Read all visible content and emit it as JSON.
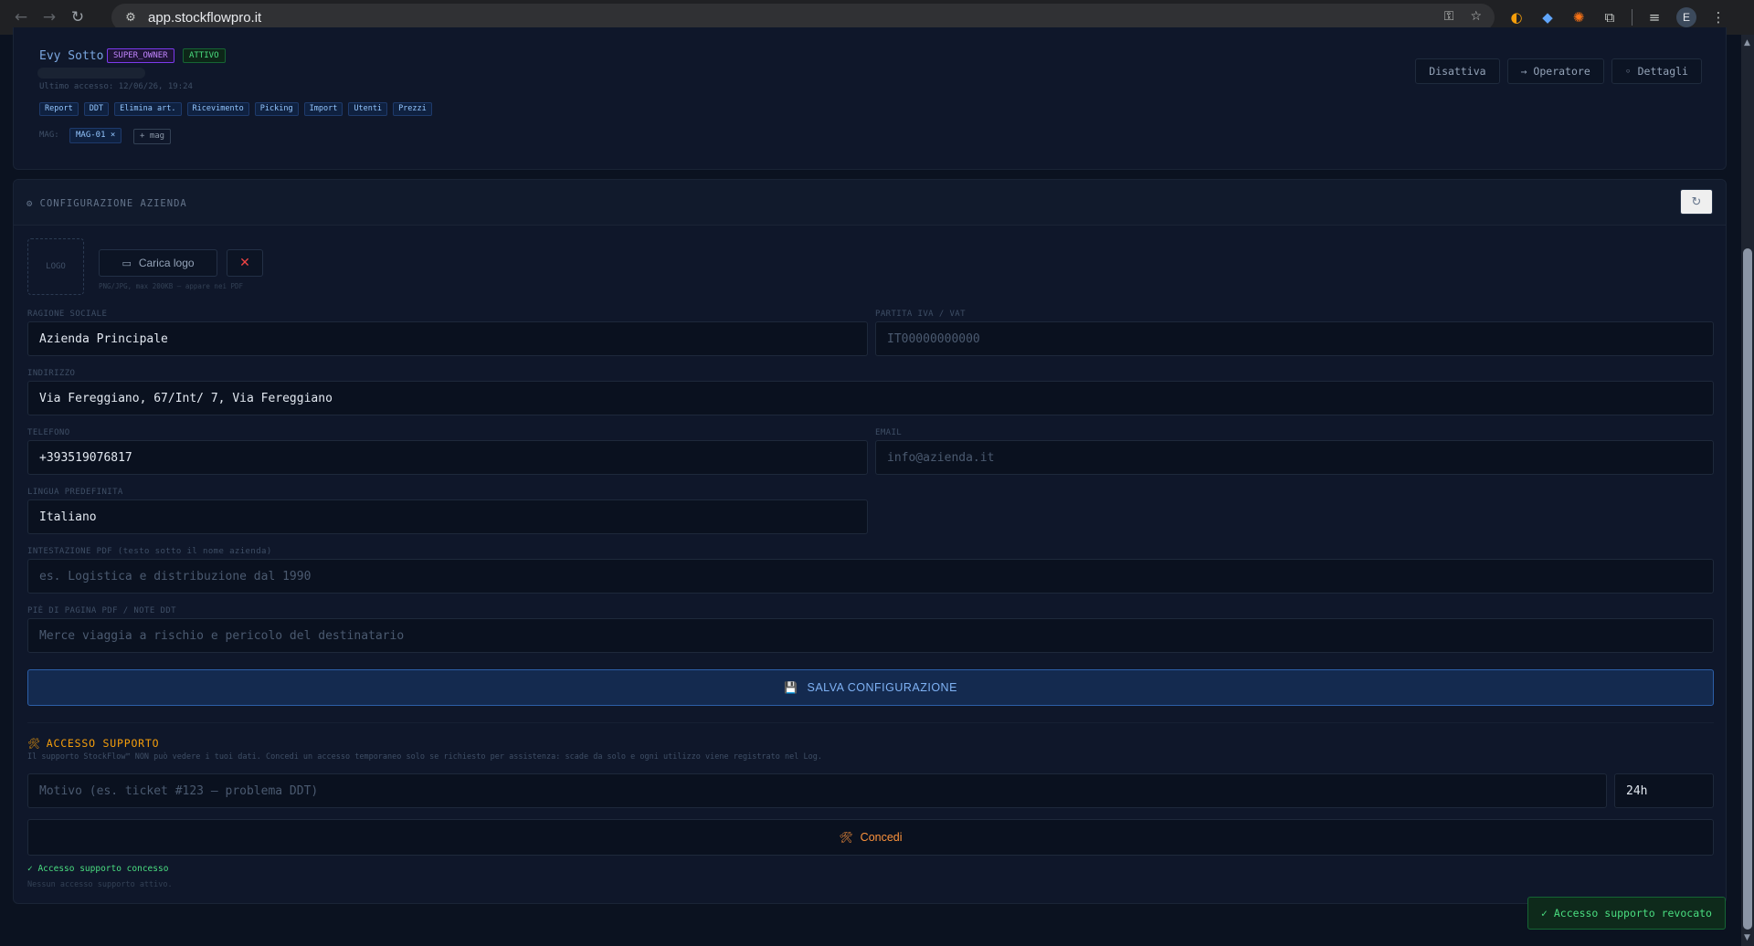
{
  "browser": {
    "url": "app.stockflowpro.it",
    "nav": {
      "back": "←",
      "forward": "→",
      "reload": "↻"
    },
    "omni_icons": [
      "key-icon",
      "star-icon"
    ],
    "extension_icons": [
      "extension-1-icon",
      "extension-2-icon",
      "extension-3-icon",
      "puzzle-icon",
      "media-icon"
    ],
    "profile_initial": "E",
    "menu": "⋮"
  },
  "user_card": {
    "name": "Evy Sotto",
    "role_badge": "SUPER_OWNER",
    "status_badge": "ATTIVO",
    "last_access": "Ultimo accesso: 12/06/26, 19:24",
    "permissions": [
      "Report",
      "DDT",
      "Elimina art.",
      "Ricevimento",
      "Picking",
      "Import",
      "Utenti",
      "Prezzi"
    ],
    "mag_label": "MAG:",
    "mag_chip": "MAG-01 ×",
    "mag_add": "+ mag",
    "actions": {
      "deactivate": "Disattiva",
      "operator": "→ Operatore",
      "details": "◦ Dettagli"
    }
  },
  "config": {
    "title": "⚙ CONFIGURAZIONE AZIENDA",
    "refresh": "↻",
    "logo_placeholder": "LOGO",
    "upload_icon": "▭",
    "upload_label": "Carica logo",
    "remove_icon": "✕",
    "logo_hint": "PNG/JPG, max 200KB — appare nei PDF",
    "fields": {
      "ragione_sociale": {
        "label": "RAGIONE SOCIALE",
        "value": "Azienda Principale"
      },
      "partita_iva": {
        "label": "PARTITA IVA / VAT",
        "placeholder": "IT00000000000"
      },
      "indirizzo": {
        "label": "INDIRIZZO",
        "value": "Via Fereggiano, 67/Int/ 7, Via Fereggiano"
      },
      "telefono": {
        "label": "TELEFONO",
        "value": "+393519076817"
      },
      "email": {
        "label": "EMAIL",
        "placeholder": "info@azienda.it"
      },
      "lingua": {
        "label": "LINGUA PREDEFINITA",
        "value": "Italiano"
      },
      "intestazione": {
        "label": "INTESTAZIONE PDF (testo sotto il nome azienda)",
        "placeholder": "es. Logistica e distribuzione dal 1990"
      },
      "pie_pagina": {
        "label": "PIÈ DI PAGINA PDF / NOTE DDT",
        "placeholder": "Merce viaggia a rischio e pericolo del destinatario"
      }
    },
    "save_icon": "💾",
    "save_label": "SALVA CONFIGURAZIONE"
  },
  "support": {
    "icon": "🛠",
    "title": "ACCESSO SUPPORTO",
    "description": "Il supporto StockFlow™ NON può vedere i tuoi dati. Concedi un accesso temporaneo solo se richiesto per assistenza: scade da solo e ogni utilizzo viene registrato nel Log.",
    "reason_placeholder": "Motivo (es. ticket #123 — problema DDT)",
    "duration": "24h",
    "grant_icon": "🛠",
    "grant_label": "Concedi",
    "granted_message": "✓ Accesso supporto concesso",
    "no_access": "Nessun accesso supporto attivo."
  },
  "toast": {
    "message": "✓ Accesso supporto revocato"
  },
  "colors": {
    "background": "#0b1220",
    "card": "#0f172a",
    "accent_blue": "#7fb2f5",
    "support_orange": "#f59e0b",
    "success_green": "#4ade80",
    "owner_purple": "#c084fc"
  }
}
